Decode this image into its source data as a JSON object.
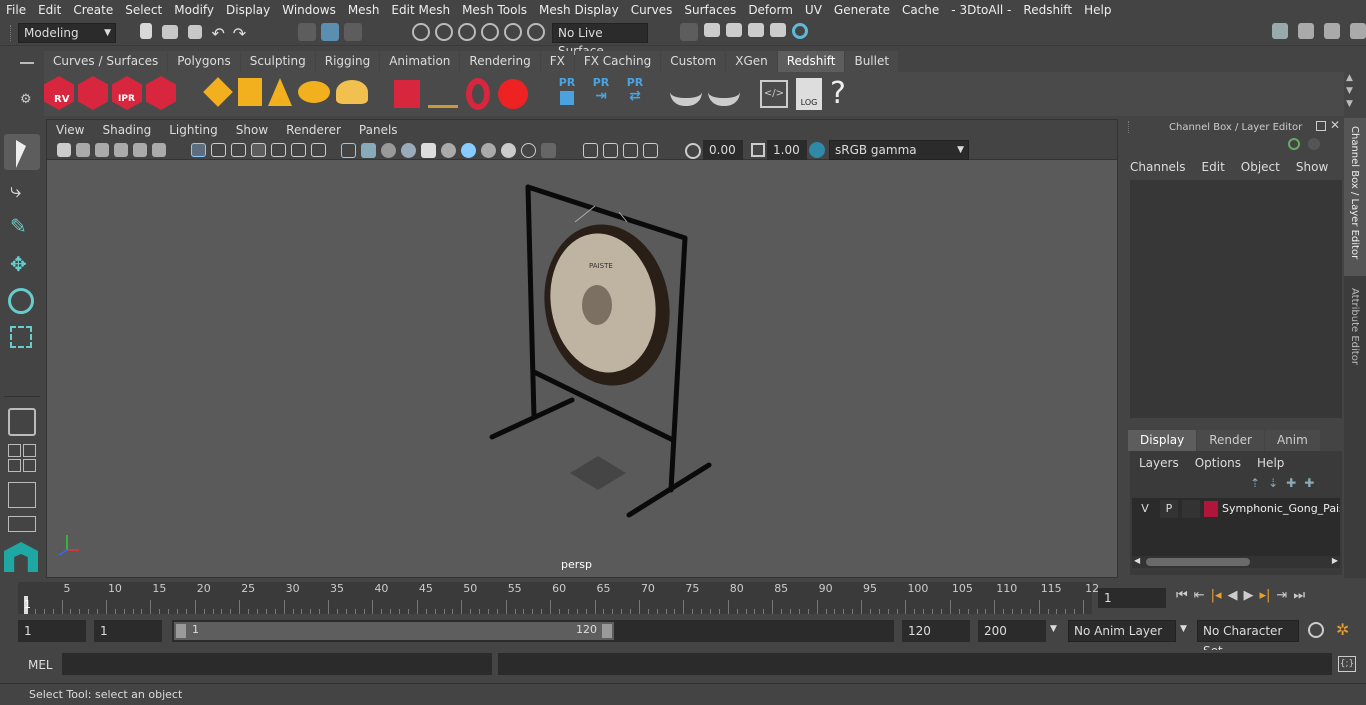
{
  "menu": [
    "File",
    "Edit",
    "Create",
    "Select",
    "Modify",
    "Display",
    "Windows",
    "Mesh",
    "Edit Mesh",
    "Mesh Tools",
    "Mesh Display",
    "Curves",
    "Surfaces",
    "Deform",
    "UV",
    "Generate",
    "Cache",
    "- 3DtoAll -",
    "Redshift",
    "Help"
  ],
  "statusline": {
    "mode": "Modeling",
    "live_surface": "No Live Surface"
  },
  "shelf_tabs": [
    "Curves / Surfaces",
    "Polygons",
    "Sculpting",
    "Rigging",
    "Animation",
    "Rendering",
    "FX",
    "FX Caching",
    "Custom",
    "XGen",
    "Redshift",
    "Bullet"
  ],
  "active_shelf_tab": "Redshift",
  "shelf_icon_labels": {
    "rv": "RV",
    "ipr": "IPR",
    "pr": "PR",
    "log": "LOG",
    "help": "?"
  },
  "viewport": {
    "menu": [
      "View",
      "Shading",
      "Lighting",
      "Show",
      "Renderer",
      "Panels"
    ],
    "exposure": "0.00",
    "gamma": "1.00",
    "color_space": "sRGB gamma",
    "camera_label": "persp",
    "gong_brand": "PAISTE"
  },
  "channel_box": {
    "title": "Channel Box / Layer Editor",
    "menu": [
      "Channels",
      "Edit",
      "Object",
      "Show"
    ]
  },
  "layer_editor": {
    "tabs": [
      "Display",
      "Render",
      "Anim"
    ],
    "active_tab": "Display",
    "menu": [
      "Layers",
      "Options",
      "Help"
    ],
    "layer": {
      "v": "V",
      "p": "P",
      "name": "Symphonic_Gong_Pais",
      "color": "#b0163a"
    }
  },
  "side_tabs": [
    "Channel Box / Layer Editor",
    "Attribute Editor"
  ],
  "timeline": {
    "ticks": [
      "5",
      "10",
      "15",
      "20",
      "25",
      "30",
      "35",
      "40",
      "45",
      "50",
      "55",
      "60",
      "65",
      "70",
      "75",
      "80",
      "85",
      "90",
      "95",
      "100",
      "105",
      "110",
      "115",
      "12"
    ],
    "start_marker": "1",
    "current_frame": "1"
  },
  "range": {
    "start": "1",
    "playback_start": "1",
    "slider_start": "1",
    "slider_end": "120",
    "playback_end": "120",
    "end": "200",
    "anim_layer": "No Anim Layer",
    "character_set": "No Character Set"
  },
  "command_line": {
    "label": "MEL"
  },
  "help_line": "Select Tool: select an object"
}
